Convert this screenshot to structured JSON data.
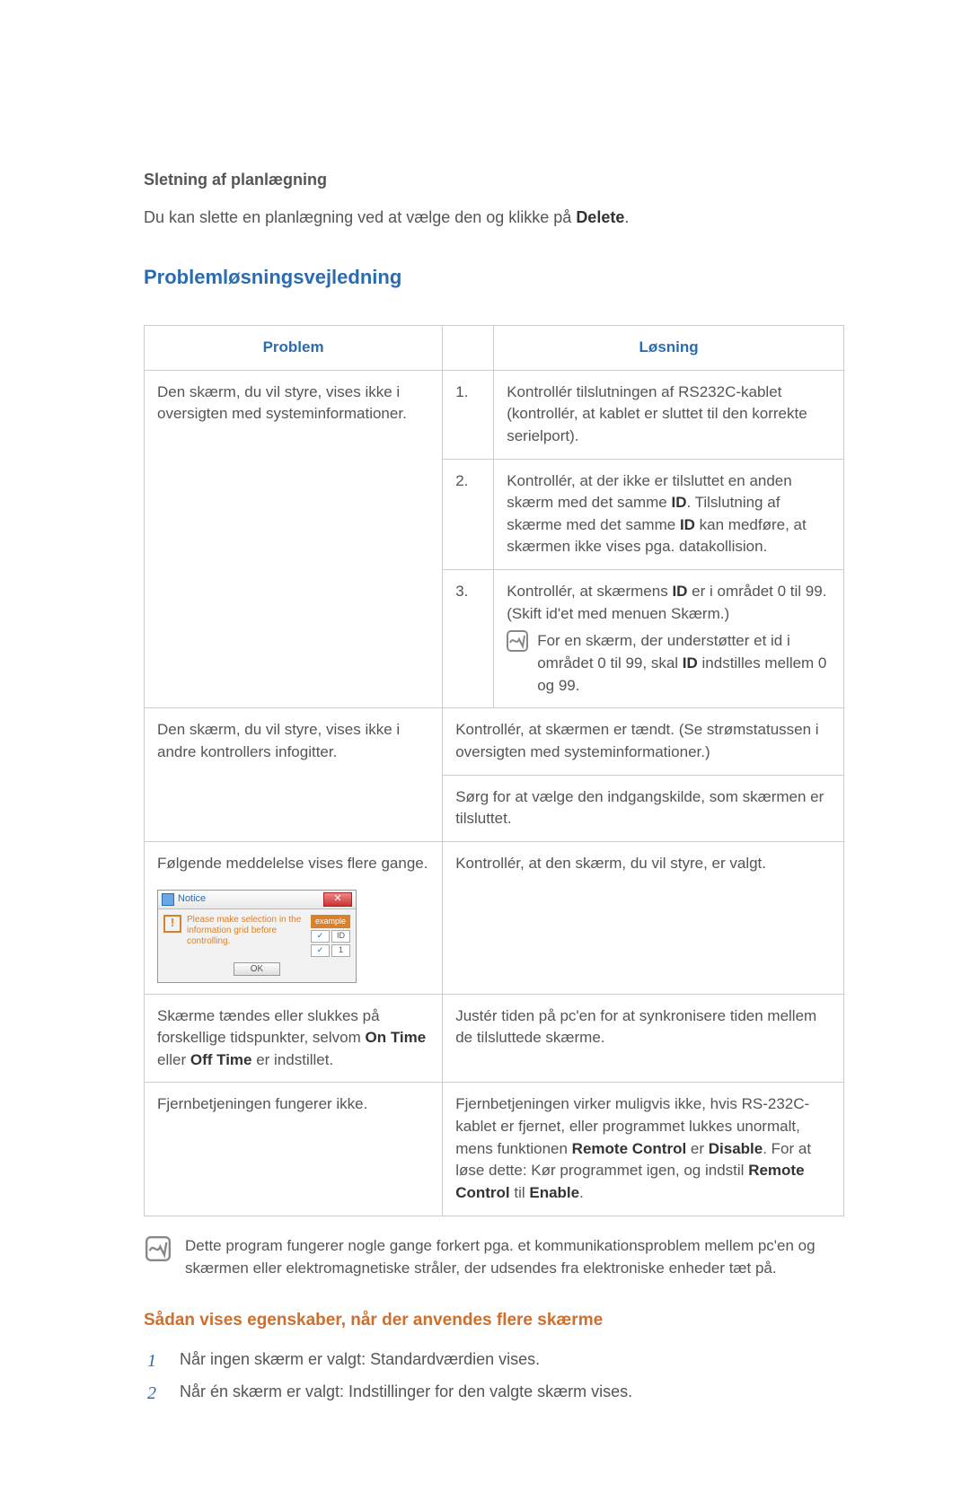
{
  "section1": {
    "title": "Sletning af planlægning",
    "text_before": "Du kan slette en planlægning ved at vælge den og klikke på ",
    "text_bold": "Delete",
    "text_after": "."
  },
  "heading_blue": "Problemløsningsvejledning",
  "table": {
    "header_problem": "Problem",
    "header_solution": "Løsning",
    "row1_problem": "Den skærm, du vil styre, vises ikke i oversigten med systeminformationer.",
    "row1_sol1_num": "1.",
    "row1_sol1": "Kontrollér tilslutningen af RS232C-kablet (kontrollér, at kablet er sluttet til den korrekte serielport).",
    "row1_sol2_num": "2.",
    "row1_sol2_a": "Kontrollér, at der ikke er tilsluttet en anden skærm med det samme ",
    "row1_sol2_b": ". Tilslutning af skærme med det samme ",
    "row1_sol2_c": " kan medføre, at skærmen ikke vises pga. datakollision.",
    "row1_sol3_num": "3.",
    "row1_sol3_a": "Kontrollér, at skærmens ",
    "row1_sol3_b": " er i området 0 til 99. (Skift id'et med menuen Skærm.)",
    "row1_sol3_note_a": "For en skærm, der understøtter et id i området 0 til 99, skal ",
    "row1_sol3_note_b": " indstilles mellem 0 og 99.",
    "bold_ID": "ID",
    "row2_problem": "Den skærm, du vil styre, vises ikke i andre kontrollers infogitter.",
    "row2_sol1": "Kontrollér, at skærmen er tændt. (Se strømstatussen i oversigten med systeminformationer.)",
    "row2_sol2": "Sørg for at vælge den indgangskilde, som skærmen er tilsluttet.",
    "row3_problem": "Følgende meddelelse vises flere gange.",
    "row3_sol": "Kontrollér, at den skærm, du vil styre, er valgt.",
    "row4_problem_a": "Skærme tændes eller slukkes på forskellige tidspunkter, selvom ",
    "row4_problem_b": " eller ",
    "row4_problem_c": " er indstillet.",
    "row4_bold1": "On Time",
    "row4_bold2": "Off Time",
    "row4_sol": "Justér tiden på pc'en for at synkronisere tiden mellem de tilsluttede skærme.",
    "row5_problem": "Fjernbetjeningen fungerer ikke.",
    "row5_sol_a": "Fjernbetjeningen virker muligvis ikke, hvis RS-232C-kablet er fjernet, eller programmet lukkes unormalt, mens funktionen ",
    "row5_sol_b": " er ",
    "row5_sol_c": ". For at løse dette: Kør programmet igen, og indstil ",
    "row5_sol_d": " til ",
    "row5_sol_e": ".",
    "row5_b1": "Remote Control",
    "row5_b2": "Disable",
    "row5_b3": "Remote Control",
    "row5_b4": "Enable"
  },
  "dialog": {
    "title": "Notice",
    "msg": "Please make selection in the information grid before controlling.",
    "example": "example",
    "id_label": "ID",
    "one": "1",
    "ok": "OK"
  },
  "footnote": "Dette program fungerer nogle gange forkert pga. et kommunikationsproblem mellem pc'en og skærmen eller elektromagnetiske stråler, der udsendes fra elektroniske enheder tæt på.",
  "heading_orange": "Sådan vises egenskaber, når der anvendes flere skærme",
  "steps": {
    "n1": "1",
    "t1": "Når ingen skærm er valgt: Standardværdien vises.",
    "n2": "2",
    "t2": "Når én skærm er valgt: Indstillinger for den valgte skærm vises."
  }
}
